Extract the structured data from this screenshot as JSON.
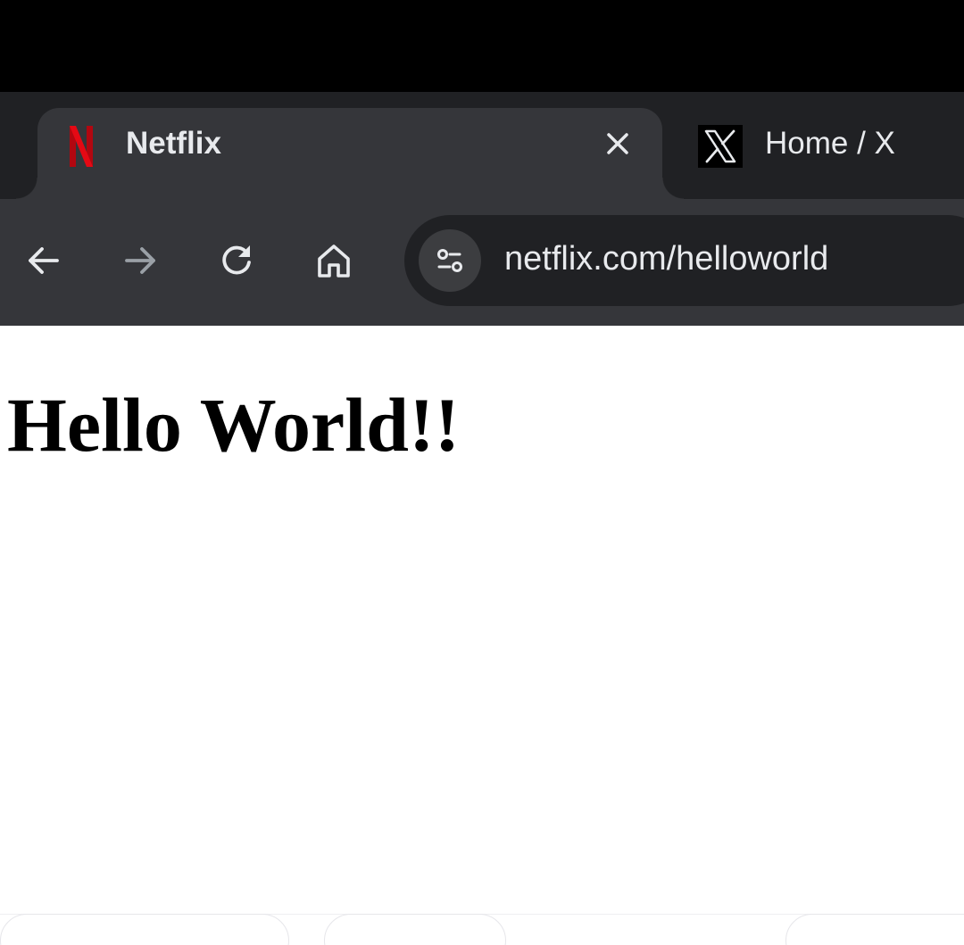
{
  "browser": {
    "tabs": [
      {
        "title": "Netflix",
        "favicon": "netflix-logo-icon",
        "active": true,
        "close_glyph": "×"
      },
      {
        "title": "Home / X",
        "favicon": "x-logo-icon",
        "active": false
      }
    ],
    "toolbar": {
      "back_icon": "arrow-left-icon",
      "forward_icon": "arrow-right-icon",
      "reload_icon": "reload-icon",
      "home_icon": "home-icon"
    },
    "omnibox": {
      "site_info_icon": "tune-icon",
      "url": "netflix.com/helloworld"
    }
  },
  "page": {
    "heading": "Hello World!!"
  },
  "colors": {
    "top_bar": "#000000",
    "tab_strip": "#202124",
    "active_tab": "#35363a",
    "omnibox": "#202124",
    "text": "#e8eaed",
    "netflix_red": "#c11119"
  }
}
